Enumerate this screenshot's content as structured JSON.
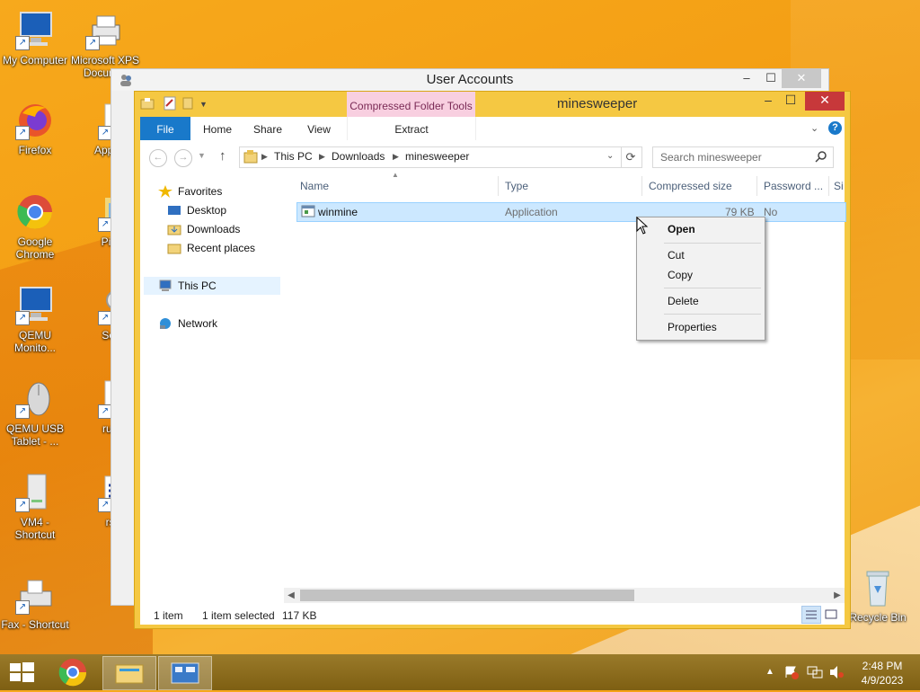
{
  "desktop": {
    "icons": [
      {
        "label": "My Computer",
        "icon": "monitor-icon"
      },
      {
        "label": "Microsoft XPS Docum...",
        "icon": "printer-icon"
      },
      {
        "label": "Firefox",
        "icon": "firefox-icon"
      },
      {
        "label": "AppexS",
        "icon": "document-icon"
      },
      {
        "label": "Google Chrome",
        "icon": "chrome-icon"
      },
      {
        "label": "Pictu",
        "icon": "pictures-icon"
      },
      {
        "label": "QEMU Monito...",
        "icon": "monitor-icon"
      },
      {
        "label": "Sear",
        "icon": "search-icon"
      },
      {
        "label": "QEMU USB Tablet - ...",
        "icon": "mouse-icon"
      },
      {
        "label": "rund",
        "icon": "document-icon"
      },
      {
        "label": "VM4 - Shortcut",
        "icon": "drive-icon"
      },
      {
        "label": "rso",
        "icon": "document-icon"
      },
      {
        "label": "Fax - Shortcut",
        "icon": "fax-icon"
      },
      {
        "label": "Recycle Bin",
        "icon": "recycle-bin-icon"
      }
    ]
  },
  "back_window": {
    "title": "User Accounts",
    "minimize": "–",
    "maximize": "☐",
    "close": "✕"
  },
  "window": {
    "title": "minesweeper",
    "contextual_tab_group": "Compressed Folder Tools",
    "minimize": "–",
    "maximize": "☐",
    "close": "✕",
    "ribbon_tabs": {
      "file": "File",
      "home": "Home",
      "share": "Share",
      "view": "View",
      "extract": "Extract"
    },
    "help": "?"
  },
  "address": {
    "crumbs": [
      "This PC",
      "Downloads",
      "minesweeper"
    ],
    "search_placeholder": "Search minesweeper"
  },
  "nav": {
    "favorites": "Favorites",
    "desktop": "Desktop",
    "downloads": "Downloads",
    "recent": "Recent places",
    "this_pc": "This PC",
    "network": "Network"
  },
  "columns": {
    "name": "Name",
    "type": "Type",
    "compressed_size": "Compressed size",
    "password": "Password ...",
    "size": "Si"
  },
  "files": [
    {
      "name": "winmine",
      "type": "Application",
      "compressed_size": "79 KB",
      "password": "No"
    }
  ],
  "status": {
    "items": "1 item",
    "selected": "1 item selected",
    "size": "117 KB"
  },
  "context_menu": {
    "open": "Open",
    "cut": "Cut",
    "copy": "Copy",
    "delete": "Delete",
    "properties": "Properties"
  },
  "taskbar": {
    "time": "2:48 PM",
    "date": "4/9/2023"
  },
  "colors": {
    "accent": "#1979ca",
    "window_frame": "#f5c842",
    "contextual_tab": "#f8cfe0",
    "selection": "#cce8ff"
  }
}
